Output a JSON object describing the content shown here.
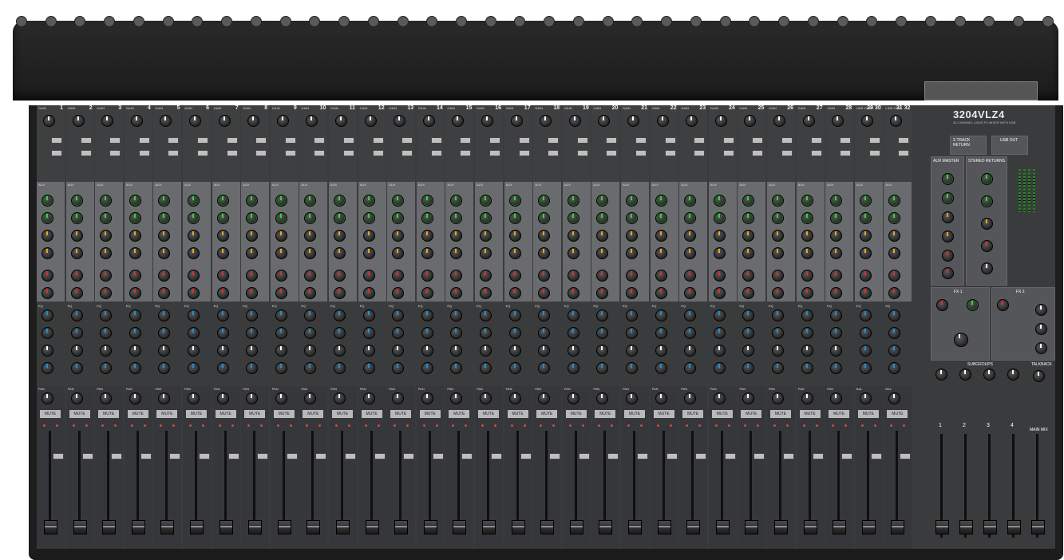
{
  "mixer": {
    "model_logo": "3204VLZ4",
    "model_subtitle": "32-CHANNEL 4-BUS FX MIXER WITH USB"
  },
  "channels": [
    {
      "num": "1",
      "gain": "GAIN"
    },
    {
      "num": "2",
      "gain": "GAIN"
    },
    {
      "num": "3",
      "gain": "GAIN"
    },
    {
      "num": "4",
      "gain": "GAIN"
    },
    {
      "num": "5",
      "gain": "GAIN"
    },
    {
      "num": "6",
      "gain": "GAIN"
    },
    {
      "num": "7",
      "gain": "GAIN"
    },
    {
      "num": "8",
      "gain": "GAIN"
    },
    {
      "num": "9",
      "gain": "GAIN"
    },
    {
      "num": "10",
      "gain": "GAIN"
    },
    {
      "num": "11",
      "gain": "GAIN"
    },
    {
      "num": "12",
      "gain": "GAIN"
    },
    {
      "num": "13",
      "gain": "GAIN"
    },
    {
      "num": "14",
      "gain": "GAIN"
    },
    {
      "num": "15",
      "gain": "GAIN"
    },
    {
      "num": "16",
      "gain": "GAIN"
    },
    {
      "num": "17",
      "gain": "GAIN"
    },
    {
      "num": "18",
      "gain": "GAIN"
    },
    {
      "num": "19",
      "gain": "GAIN"
    },
    {
      "num": "20",
      "gain": "GAIN"
    },
    {
      "num": "21",
      "gain": "GAIN"
    },
    {
      "num": "22",
      "gain": "GAIN"
    },
    {
      "num": "23",
      "gain": "GAIN"
    },
    {
      "num": "24",
      "gain": "GAIN"
    },
    {
      "num": "25",
      "gain": "GAIN"
    },
    {
      "num": "26",
      "gain": "GAIN"
    },
    {
      "num": "27",
      "gain": "GAIN"
    },
    {
      "num": "28",
      "gain": "GAIN"
    },
    {
      "num": "29 30",
      "gain": "LINE GAIN"
    },
    {
      "num": "31 32",
      "gain": "LINE GAIN"
    }
  ],
  "labels": {
    "aux": "AUX",
    "eq": "EQ",
    "pan": "PAN",
    "bal": "BAL",
    "mute": "MUTE",
    "solo": "SOLO"
  },
  "master": {
    "track_return": "2-TRACK RETURN",
    "usb_out": "USB OUT",
    "aux_master": "AUX MASTER",
    "stereo_returns": "STEREO RETURNS",
    "fx1": "FX 1",
    "fx2": "FX 2",
    "subgroups": "SUBGROUPS",
    "talkback": "TALKBACK",
    "main_mix": "MAIN MIX",
    "subgroup_nums": [
      "1",
      "2",
      "3",
      "4"
    ]
  }
}
